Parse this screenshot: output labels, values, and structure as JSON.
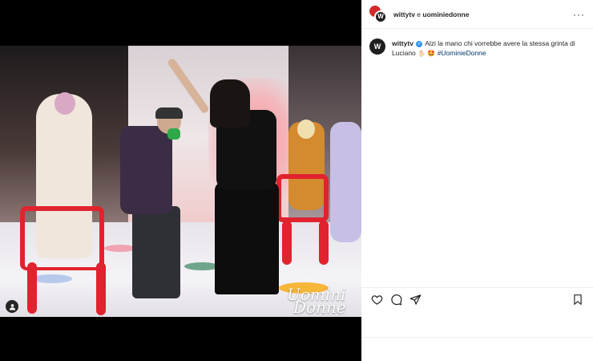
{
  "post": {
    "header_users": "wittytv e uominiedonne",
    "header_user1": "wittytv",
    "header_join": " e ",
    "header_user2": "uominiedonne",
    "avatar_letter": "W",
    "more_icon": "···"
  },
  "caption": {
    "username": "wittytv",
    "text": "Alzi la mano chi vorrebbe avere la stessa grinta di Luciano",
    "emojis": "✋🏻 🤩",
    "hashtag": "#UominieDonne"
  },
  "media": {
    "watermark_line1": "Uomini",
    "watermark_line2": "Donne"
  },
  "icons": {
    "like": "heart-icon",
    "comment": "comment-icon",
    "share": "share-icon",
    "save": "bookmark-icon",
    "user_tag": "user-tag-icon",
    "verified": "verified-badge-icon"
  },
  "colors": {
    "hashtag": "#00376b",
    "verified": "#3897f0",
    "brand_red": "#d42a2a"
  }
}
